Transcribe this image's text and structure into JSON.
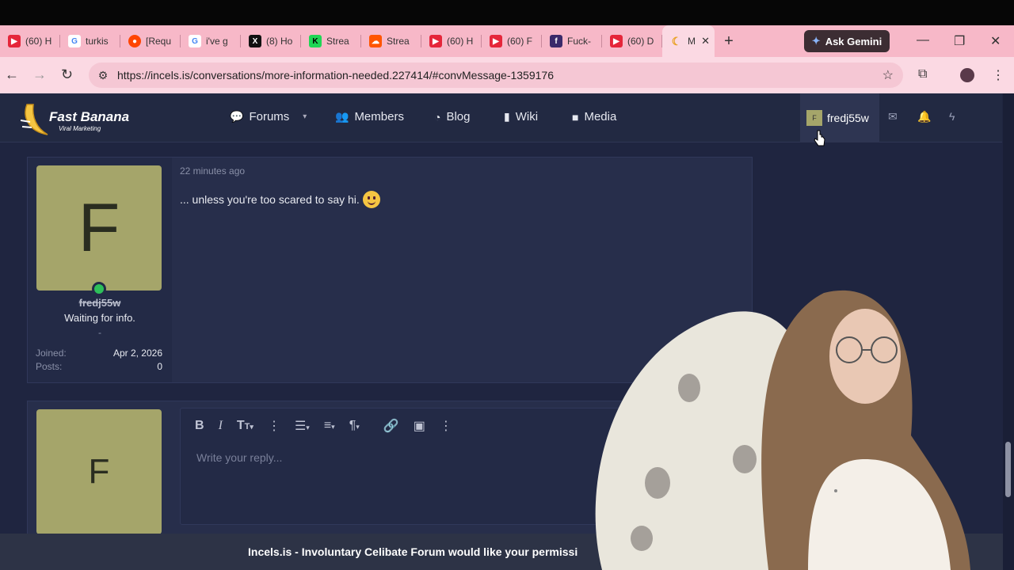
{
  "browser": {
    "tabs": [
      {
        "label": "(60) H",
        "favicon": "youtube-icon",
        "color": "#e5263a"
      },
      {
        "label": "turkis",
        "favicon": "google-icon",
        "color": "#4285f4"
      },
      {
        "label": "[Requ",
        "favicon": "reddit-icon",
        "color": "#ff4500"
      },
      {
        "label": "i've g",
        "favicon": "google-icon",
        "color": "#4285f4"
      },
      {
        "label": "(8) Ho",
        "favicon": "x-icon",
        "color": "#111111"
      },
      {
        "label": "Strea",
        "favicon": "kick-icon",
        "color": "#1fd655"
      },
      {
        "label": "Strea",
        "favicon": "soundcloud-icon",
        "color": "#ff5500"
      },
      {
        "label": "(60) H",
        "favicon": "youtube-icon",
        "color": "#e5263a"
      },
      {
        "label": "(60) F",
        "favicon": "youtube-icon",
        "color": "#e5263a"
      },
      {
        "label": "Fuck-",
        "favicon": "letterboxd-icon",
        "color": "#3a2a6a"
      },
      {
        "label": "(60) D",
        "favicon": "youtube-icon",
        "color": "#e5263a"
      },
      {
        "label": "M",
        "favicon": "fastbanana-icon",
        "color": "#f5c542",
        "active": true
      }
    ],
    "new_tab": "+",
    "gemini_label": "Ask Gemini",
    "url": "https://incels.is/conversations/more-information-needed.227414/#convMessage-1359176"
  },
  "site": {
    "logo_title": "Fast Banana",
    "logo_subtitle": "Viral Marketing",
    "nav": [
      {
        "label": "Forums",
        "icon": "comments-icon"
      },
      {
        "label": "Members",
        "icon": "users-icon"
      },
      {
        "label": "Blog",
        "icon": "rss-icon"
      },
      {
        "label": "Wiki",
        "icon": "book-icon"
      },
      {
        "label": "Media",
        "icon": "video-icon"
      }
    ],
    "username": "fredj55w",
    "user_initial": "F"
  },
  "message": {
    "avatar_letter": "F",
    "username": "fredj55w",
    "user_title": "Waiting for info.",
    "dash": "-",
    "joined_label": "Joined:",
    "joined_value": "Apr 2, 2026",
    "posts_label": "Posts:",
    "posts_value": "0",
    "time": "22 minutes ago",
    "body": "... unless you're too scared to say hi."
  },
  "reply": {
    "avatar_letter": "F",
    "placeholder": "Write your reply..."
  },
  "banner": {
    "text": "Incels.is - Involuntary Celibate Forum would like your permissi"
  }
}
